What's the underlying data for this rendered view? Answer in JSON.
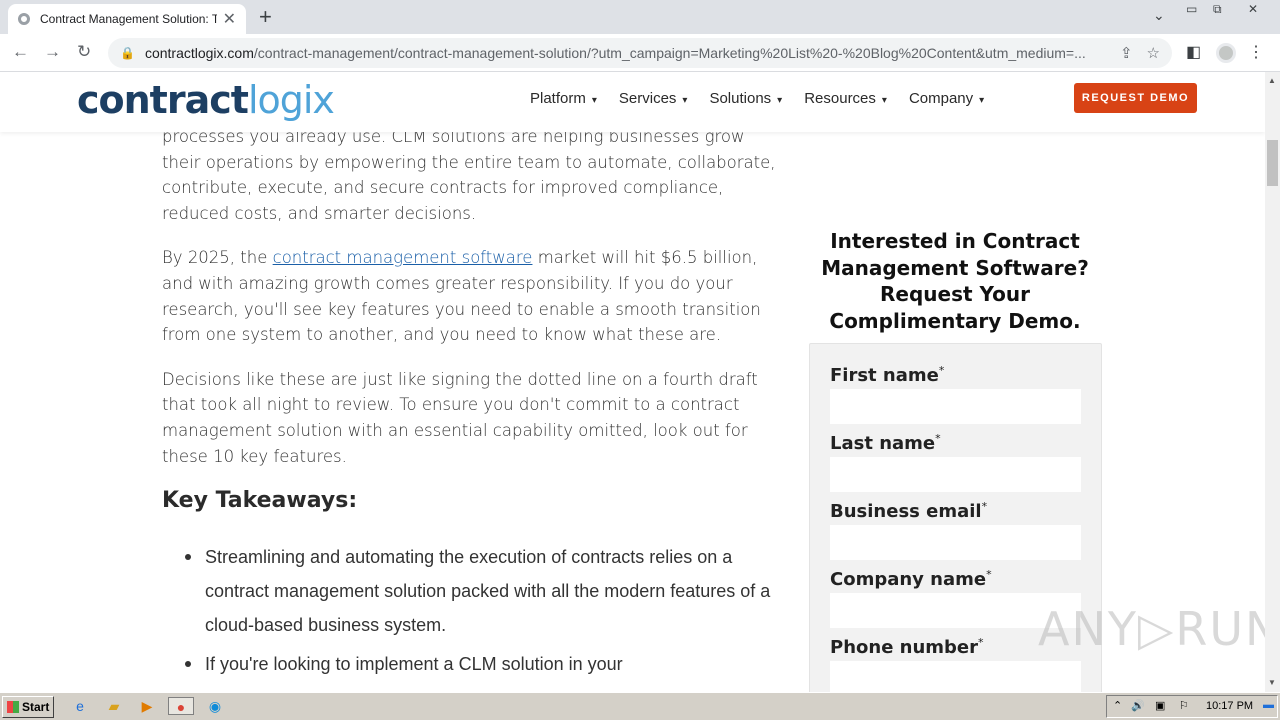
{
  "browser": {
    "tab_title": "Contract Management Solution: The",
    "tab_close": "✕",
    "new_tab": "+",
    "url_domain": "contractlogix.com",
    "url_path": "/contract-management/contract-management-solution/?utm_campaign=Marketing%20List%20-%20Blog%20Content&utm_medium=...",
    "back": "←",
    "forward": "→",
    "reload": "↻"
  },
  "site": {
    "logo_a": "contract",
    "logo_b": "logix",
    "menu": [
      {
        "label": "Platform"
      },
      {
        "label": "Services"
      },
      {
        "label": "Solutions"
      },
      {
        "label": "Resources"
      },
      {
        "label": "Company"
      }
    ],
    "cta": "REQUEST DEMO"
  },
  "article": {
    "p1": "processes you already use. CLM solutions are helping businesses grow their operations by empowering the entire team to automate, collaborate, contribute, execute, and secure contracts for improved compliance, reduced costs, and smarter decisions.",
    "p2_pre": "By 2025, the ",
    "p2_link": "contract management software",
    "p2_post": " market will hit $6.5 billion, and with amazing growth comes greater responsibility. If you do your research, you'll see key features you need to enable a smooth transition from one system to another, and you need to know what these are.",
    "p3": "Decisions like these are just like signing the dotted line on a fourth draft that took all night to review. To ensure you don't commit to a contract management solution with an essential capability omitted, look out for these 10 key features.",
    "h2": "Key Takeaways:",
    "bullets": [
      "Streamlining and automating the execution of contracts relies on a contract management solution packed with all the modern features of a cloud-based business system.",
      "If you're looking to implement a CLM solution in your"
    ]
  },
  "sidebar": {
    "heading": "Interested in Contract Management Software? Request Your Complimentary Demo.",
    "fields": [
      {
        "label": "First name"
      },
      {
        "label": "Last name"
      },
      {
        "label": "Business email"
      },
      {
        "label": "Company name"
      },
      {
        "label": "Phone number"
      }
    ],
    "required": "*"
  },
  "watermark": "ANY▷RUN",
  "taskbar": {
    "start": "Start",
    "clock": "10:17 PM"
  }
}
